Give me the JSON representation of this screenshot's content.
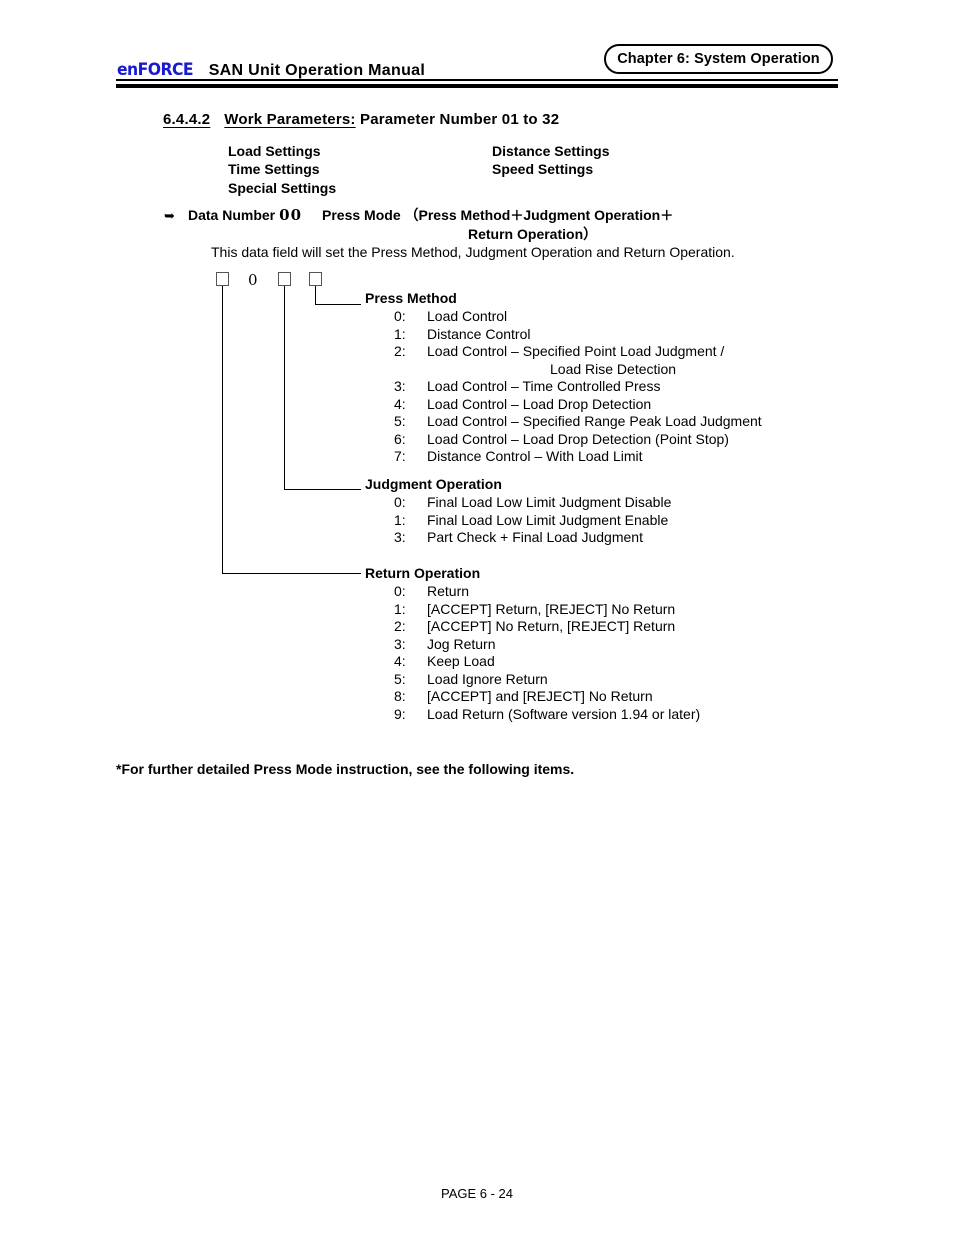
{
  "header": {
    "logo_text": "enFORCE",
    "logo_color": "#1a1ad0",
    "manual_title": "SAN  Unit  Operation  Manual",
    "chapter_badge": "Chapter 6: System Operation"
  },
  "section": {
    "number": "6.4.4.2",
    "underlined_title": "Work Parameters:",
    "trailing_title": "Parameter Number 01 to 32"
  },
  "settings": {
    "rows": [
      {
        "left": "Load Settings",
        "right": "Distance Settings"
      },
      {
        "left": "Time Settings",
        "right": "Speed Settings"
      },
      {
        "left": "Special Settings",
        "right": ""
      }
    ]
  },
  "data_number": {
    "bullet": "arrow-bullet-icon",
    "label": "Data Number",
    "value": "00",
    "mode": "Press Mode",
    "formula_open": "（",
    "formula_part1": "Press Method",
    "formula_plus1": "＋",
    "formula_part2": "Judgment Operation",
    "formula_plus2": "＋",
    "formula_part3": "Return Operation",
    "formula_close": "）",
    "description": "This data field will set the Press Method, Judgment Operation and Return Operation."
  },
  "diagram": {
    "digit_zero": "0",
    "squares": 3
  },
  "branches": [
    {
      "title": "Press Method",
      "options": [
        {
          "key": "0:",
          "value": "Load Control",
          "cont": ""
        },
        {
          "key": "1:",
          "value": "Distance Control",
          "cont": ""
        },
        {
          "key": "2:",
          "value": " Load Control – Specified Point Load Judgment /",
          "cont": "Load Rise Detection"
        },
        {
          "key": "3:",
          "value": "Load Control – Time Controlled Press",
          "cont": ""
        },
        {
          "key": "4:",
          "value": "Load Control – Load Drop Detection",
          "cont": ""
        },
        {
          "key": "5:",
          "value": "Load Control – Specified Range Peak Load Judgment",
          "cont": ""
        },
        {
          "key": "6:",
          "value": "Load Control – Load Drop Detection (Point Stop)",
          "cont": ""
        },
        {
          "key": "7:",
          "value": "Distance Control – With Load Limit",
          "cont": ""
        }
      ]
    },
    {
      "title": "Judgment Operation",
      "options": [
        {
          "key": "0:",
          "value": "Final Load Low Limit Judgment Disable",
          "cont": ""
        },
        {
          "key": "1:",
          "value": "Final Load Low Limit Judgment Enable",
          "cont": ""
        },
        {
          "key": "3:",
          "value": "Part Check + Final Load Judgment",
          "cont": ""
        }
      ]
    },
    {
      "title": "Return Operation",
      "options": [
        {
          "key": "0:",
          "value": "Return",
          "cont": ""
        },
        {
          "key": "1:",
          "value": "[ACCEPT] Return, [REJECT] No Return",
          "cont": ""
        },
        {
          "key": "2:",
          "value": "[ACCEPT] No Return, [REJECT] Return",
          "cont": ""
        },
        {
          "key": "3:",
          "value": "Jog Return",
          "cont": ""
        },
        {
          "key": "4:",
          "value": "Keep Load",
          "cont": ""
        },
        {
          "key": "5:",
          "value": "Load Ignore Return",
          "cont": ""
        },
        {
          "key": "8:",
          "value": "[ACCEPT] and [REJECT] No Return",
          "cont": ""
        },
        {
          "key": "9:",
          "value": "Load Return (Software version 1.94 or later)",
          "cont": ""
        }
      ]
    }
  ],
  "footnote": "*For further detailed Press Mode instruction, see the following items.",
  "footer": {
    "page_label": "PAGE 6 - 24"
  }
}
